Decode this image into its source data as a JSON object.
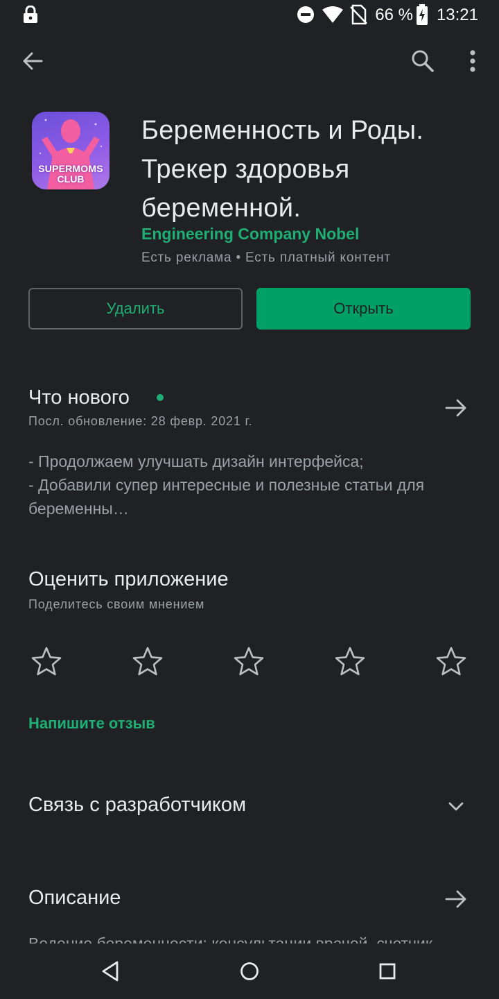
{
  "status_bar": {
    "battery": "66 %",
    "time": "13:21",
    "icons": [
      "lock-icon",
      "dnd-icon",
      "wifi-icon",
      "no-sim-icon",
      "battery-charging-icon"
    ]
  },
  "app_bar": {
    "icons": [
      "back-arrow-icon",
      "search-icon",
      "more-vert-icon"
    ]
  },
  "app": {
    "icon_text_line1": "SUPERMOMS",
    "icon_text_line2": "CLUB",
    "title": "Беременность и Роды. Трекер здоровья беременной.",
    "developer": "Engineering Company Nobel",
    "meta": "Есть реклама  •  Есть платный контент"
  },
  "buttons": {
    "uninstall": "Удалить",
    "open": "Открыть"
  },
  "whats_new": {
    "title": "Что нового",
    "updated": "Посл. обновление: 28 февр. 2021 г.",
    "line1": "- Продолжаем улучшать дизайн интерфейса;",
    "line2": "- Добавили супер интересные и полезные статьи для",
    "line3": "беременны…"
  },
  "rate": {
    "title": "Оценить приложение",
    "subtitle": "Поделитесь своим мнением",
    "stars_selected": 0,
    "stars_total": 5,
    "write_review": "Напишите отзыв"
  },
  "contact": {
    "title": "Связь с разработчиком"
  },
  "description": {
    "title": "Описание",
    "preview": "Ведение беременности: консультации врачей, счетчик"
  },
  "colors": {
    "background": "#202124",
    "accent": "#01a067",
    "accent_text": "#1fae73",
    "secondary_text": "#9aa0a6"
  }
}
